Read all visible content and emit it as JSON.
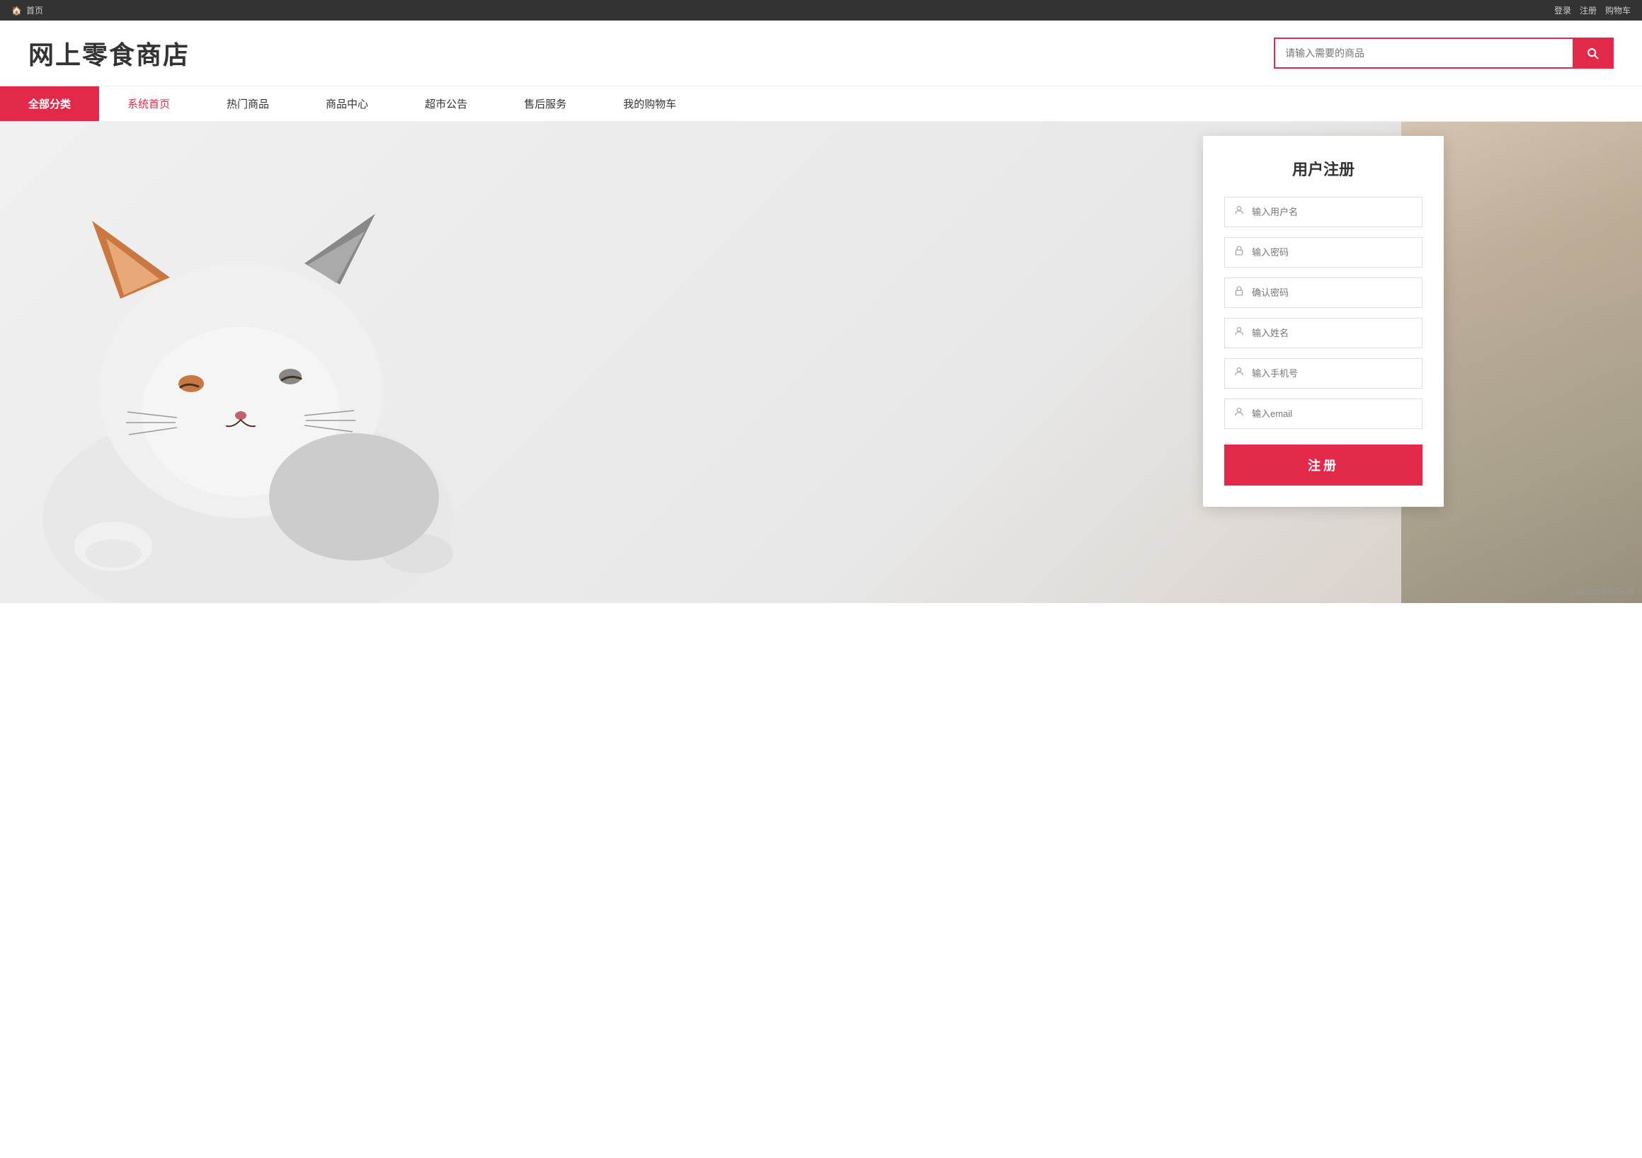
{
  "topbar": {
    "home_icon": "🏠",
    "home_label": "首页",
    "login_label": "登录",
    "register_label": "注册",
    "cart_label": "购物车"
  },
  "header": {
    "logo": "网上零食商店",
    "search_placeholder": "请输入需要的商品"
  },
  "nav": {
    "items": [
      {
        "label": "全部分类",
        "type": "active-cat"
      },
      {
        "label": "系统首页",
        "type": "active-home"
      },
      {
        "label": "热门商品",
        "type": ""
      },
      {
        "label": "商品中心",
        "type": ""
      },
      {
        "label": "超市公告",
        "type": ""
      },
      {
        "label": "售后服务",
        "type": ""
      },
      {
        "label": "我的购物车",
        "type": ""
      }
    ]
  },
  "register": {
    "title": "用户注册",
    "fields": [
      {
        "placeholder": "输入用户名",
        "icon": "person"
      },
      {
        "placeholder": "输入密码",
        "icon": "lock"
      },
      {
        "placeholder": "确认密码",
        "icon": "lock"
      },
      {
        "placeholder": "输入姓名",
        "icon": "person"
      },
      {
        "placeholder": "输入手机号",
        "icon": "person"
      },
      {
        "placeholder": "输入email",
        "icon": "person"
      }
    ],
    "button_label": "注册"
  },
  "watermark": "CSDN @经验源码库"
}
